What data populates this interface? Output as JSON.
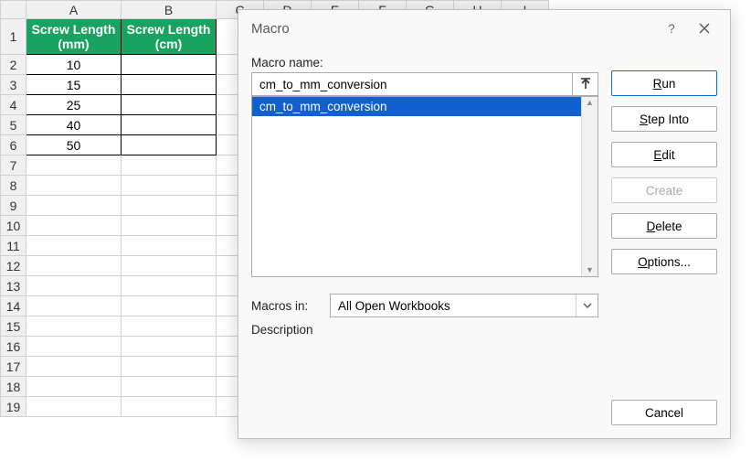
{
  "sheet": {
    "colheads": [
      "A",
      "B",
      "C",
      "D",
      "E",
      "F",
      "G",
      "H",
      "I"
    ],
    "rowheads": [
      "1",
      "2",
      "3",
      "4",
      "5",
      "6",
      "7",
      "8",
      "9",
      "10",
      "11",
      "12",
      "13",
      "14",
      "15",
      "16",
      "17",
      "18",
      "19"
    ],
    "headerA": "Screw Length (mm)",
    "headerB": "Screw Length (cm)",
    "dataA": [
      "10",
      "15",
      "25",
      "40",
      "50"
    ]
  },
  "dialog": {
    "title": "Macro",
    "labels": {
      "macro_name": "Macro name:",
      "macros_in": "Macros in:",
      "description": "Description"
    },
    "macro_name_value": "cm_to_mm_conversion",
    "list": {
      "items": [
        "cm_to_mm_conversion"
      ]
    },
    "macros_in_value": "All Open Workbooks",
    "buttons": {
      "run": "Run",
      "step_into": "Step Into",
      "edit": "Edit",
      "create": "Create",
      "delete": "Delete",
      "options": "Options...",
      "cancel": "Cancel"
    }
  }
}
